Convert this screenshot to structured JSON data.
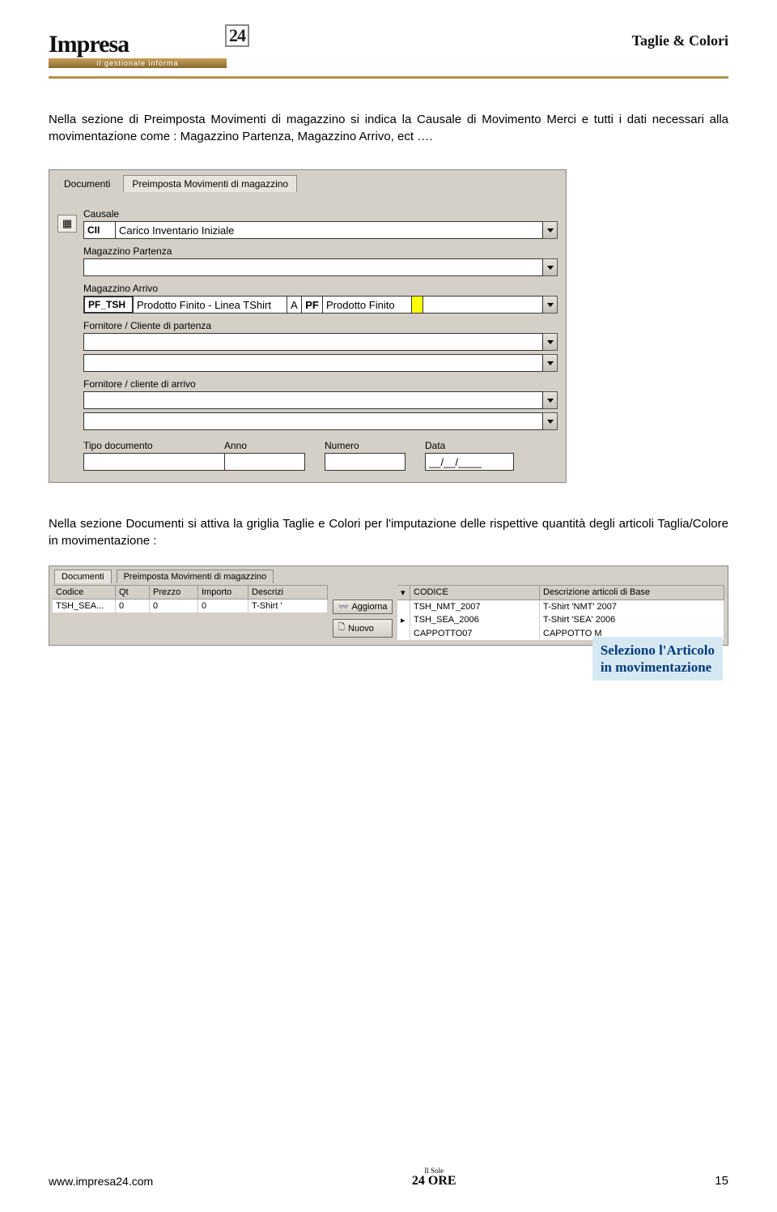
{
  "header": {
    "logo_text": "Impresa",
    "logo_24": "24",
    "logo_tagline": "il gestionale informa",
    "section_title": "Taglie & Colori"
  },
  "para1": "Nella sezione di Preimposta Movimenti di magazzino si indica la Causale di Movimento Merci e tutti i dati necessari alla movimentazione come : Magazzino Partenza, Magazzino Arrivo, ect ….",
  "form1": {
    "tabs": {
      "tab0": "Documenti",
      "tab1": "Preimposta Movimenti di magazzino"
    },
    "causale_label": "Causale",
    "causale_code": "CII",
    "causale_desc": "Carico Inventario Iniziale",
    "mag_partenza_label": "Magazzino Partenza",
    "mag_arrivo_label": "Magazzino Arrivo",
    "arrivo_code": "PF_TSH",
    "arrivo_desc1": "Prodotto Finito - Linea TShirt",
    "arrivo_col_a": "A",
    "arrivo_col_pf": "PF",
    "arrivo_desc2": "Prodotto Finito",
    "forn_partenza_label": "Fornitore / Cliente di partenza",
    "forn_arrivo_label": "Fornitore / cliente di arrivo",
    "tipo_doc_label": "Tipo documento",
    "anno_label": "Anno",
    "numero_label": "Numero",
    "data_label": "Data",
    "data_val": "__/__/____"
  },
  "para2": "Nella sezione Documenti si attiva la griglia Taglie e Colori per l'imputazione delle rispettive quantità degli articoli Taglia/Colore in movimentazione :",
  "form2": {
    "tabs": {
      "tab0": "Documenti",
      "tab1": "Preimposta Movimenti di magazzino"
    },
    "cols_left": {
      "c0": "Codice",
      "c1": "Qt",
      "c2": "Prezzo",
      "c3": "Importo",
      "c4": "Descrizi"
    },
    "row_left": {
      "c0": "TSH_SEA...",
      "c1": "0",
      "c2": "0",
      "c3": "0",
      "c4": "T-Shirt '"
    },
    "btn_aggiorna": "Aggiorna",
    "btn_nuovo": "Nuovo",
    "cols_right": {
      "c0": "CODICE",
      "c1": "Descrizione articoli di Base"
    },
    "rows_right": [
      {
        "code": "TSH_NMT_2007",
        "desc": "T-Shirt 'NMT' 2007"
      },
      {
        "code": "TSH_SEA_2006",
        "desc": "T-Shirt 'SEA' 2006"
      },
      {
        "code": "CAPPOTTO07",
        "desc": "CAPPOTTO M"
      }
    ]
  },
  "callout": {
    "line1": "Seleziono l'Articolo",
    "line2": "in movimentazione"
  },
  "footer": {
    "url": "www.impresa24.com",
    "sole_small": "Il Sole",
    "sole_big": "24 ORE",
    "page_num": "15"
  }
}
